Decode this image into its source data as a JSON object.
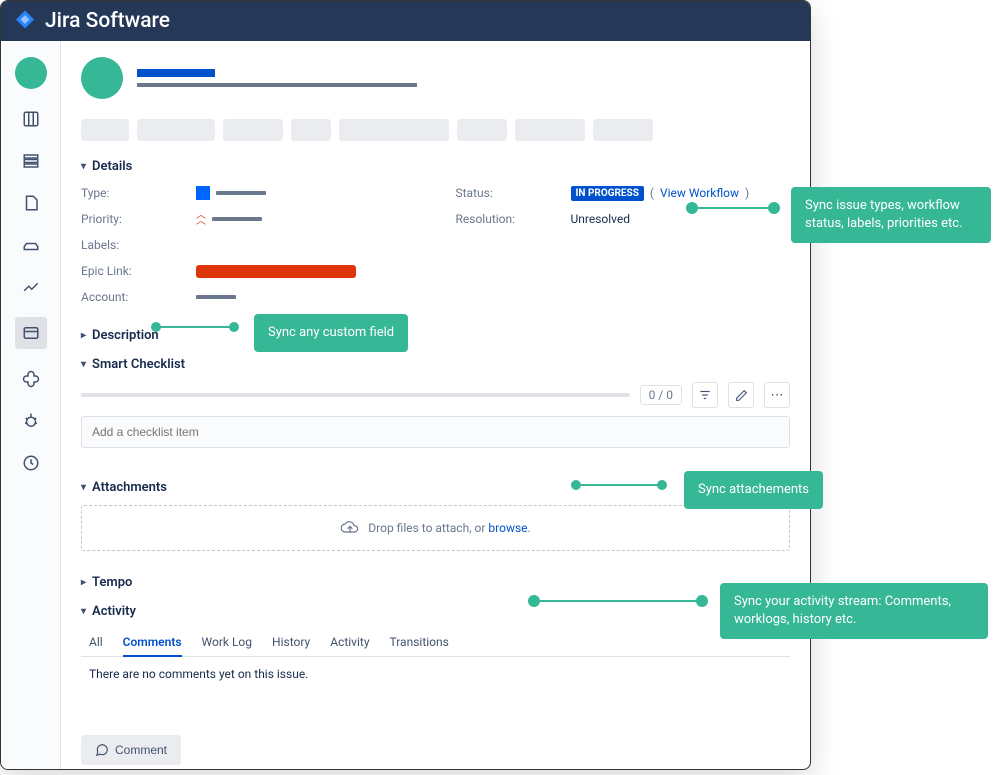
{
  "app": {
    "name": "Jira Software"
  },
  "sections": {
    "details": "Details",
    "description": "Description",
    "smart_checklist": "Smart Checklist",
    "attachments": "Attachments",
    "tempo": "Tempo",
    "activity": "Activity"
  },
  "details": {
    "left": {
      "type_label": "Type:",
      "priority_label": "Priority:",
      "labels_label": "Labels:",
      "epic_link_label": "Epic Link:",
      "account_label": "Account:"
    },
    "right": {
      "status_label": "Status:",
      "status_value": "IN PROGRESS",
      "view_workflow": "View Workflow",
      "resolution_label": "Resolution:",
      "resolution_value": "Unresolved"
    }
  },
  "checklist": {
    "count": "0 / 0",
    "placeholder": "Add a checklist item"
  },
  "attachments": {
    "drop_prefix": "Drop files to attach, or ",
    "browse": "browse",
    "drop_suffix": "."
  },
  "activity": {
    "tabs": [
      "All",
      "Comments",
      "Work Log",
      "History",
      "Activity",
      "Transitions"
    ],
    "active_tab": "Comments",
    "empty": "There are no comments yet on this issue."
  },
  "comment_button": "Comment",
  "callouts": {
    "c1": "Sync issue types, workflow status, labels, priorities etc.",
    "c2": "Sync any custom field",
    "c3": "Sync attachements",
    "c4": "Sync your activity stream: Comments, worklogs, history etc."
  }
}
